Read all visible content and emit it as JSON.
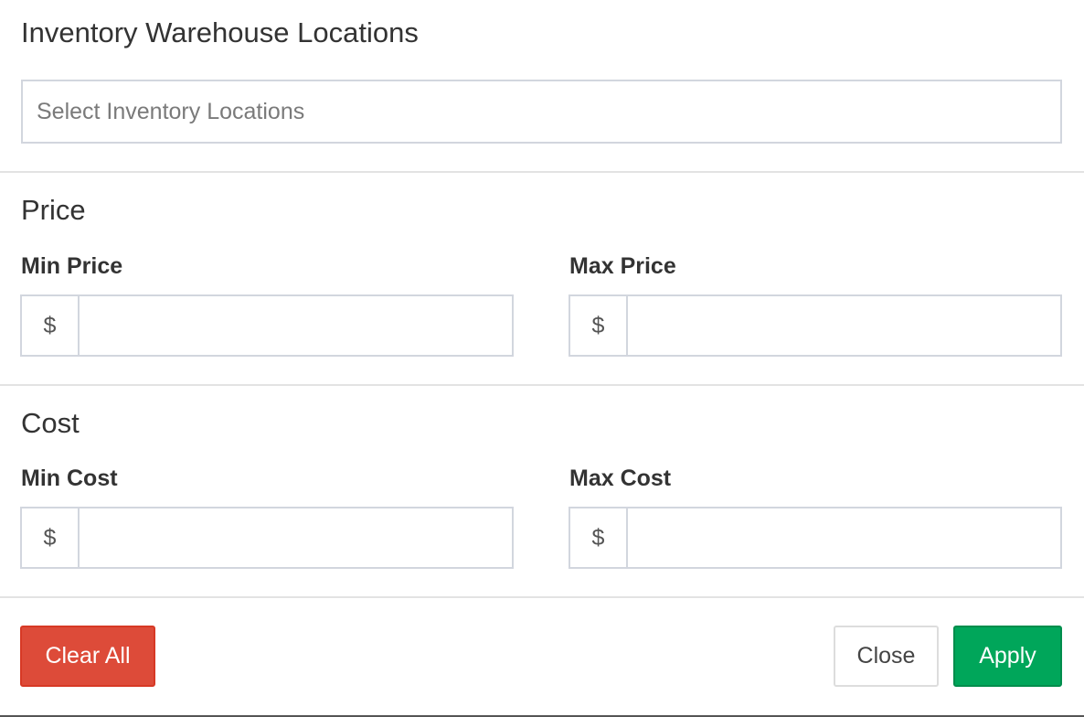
{
  "locations": {
    "title": "Inventory Warehouse Locations",
    "placeholder": "Select Inventory Locations",
    "value": ""
  },
  "price": {
    "title": "Price",
    "min_label": "Min Price",
    "max_label": "Max Price",
    "currency_symbol": "$",
    "min_value": "",
    "max_value": ""
  },
  "cost": {
    "title": "Cost",
    "min_label": "Min Cost",
    "max_label": "Max Cost",
    "currency_symbol": "$",
    "min_value": "",
    "max_value": ""
  },
  "footer": {
    "clear_label": "Clear All",
    "close_label": "Close",
    "apply_label": "Apply"
  },
  "colors": {
    "danger": "#dd4b39",
    "success": "#00a65a",
    "border": "#d2d6de"
  }
}
